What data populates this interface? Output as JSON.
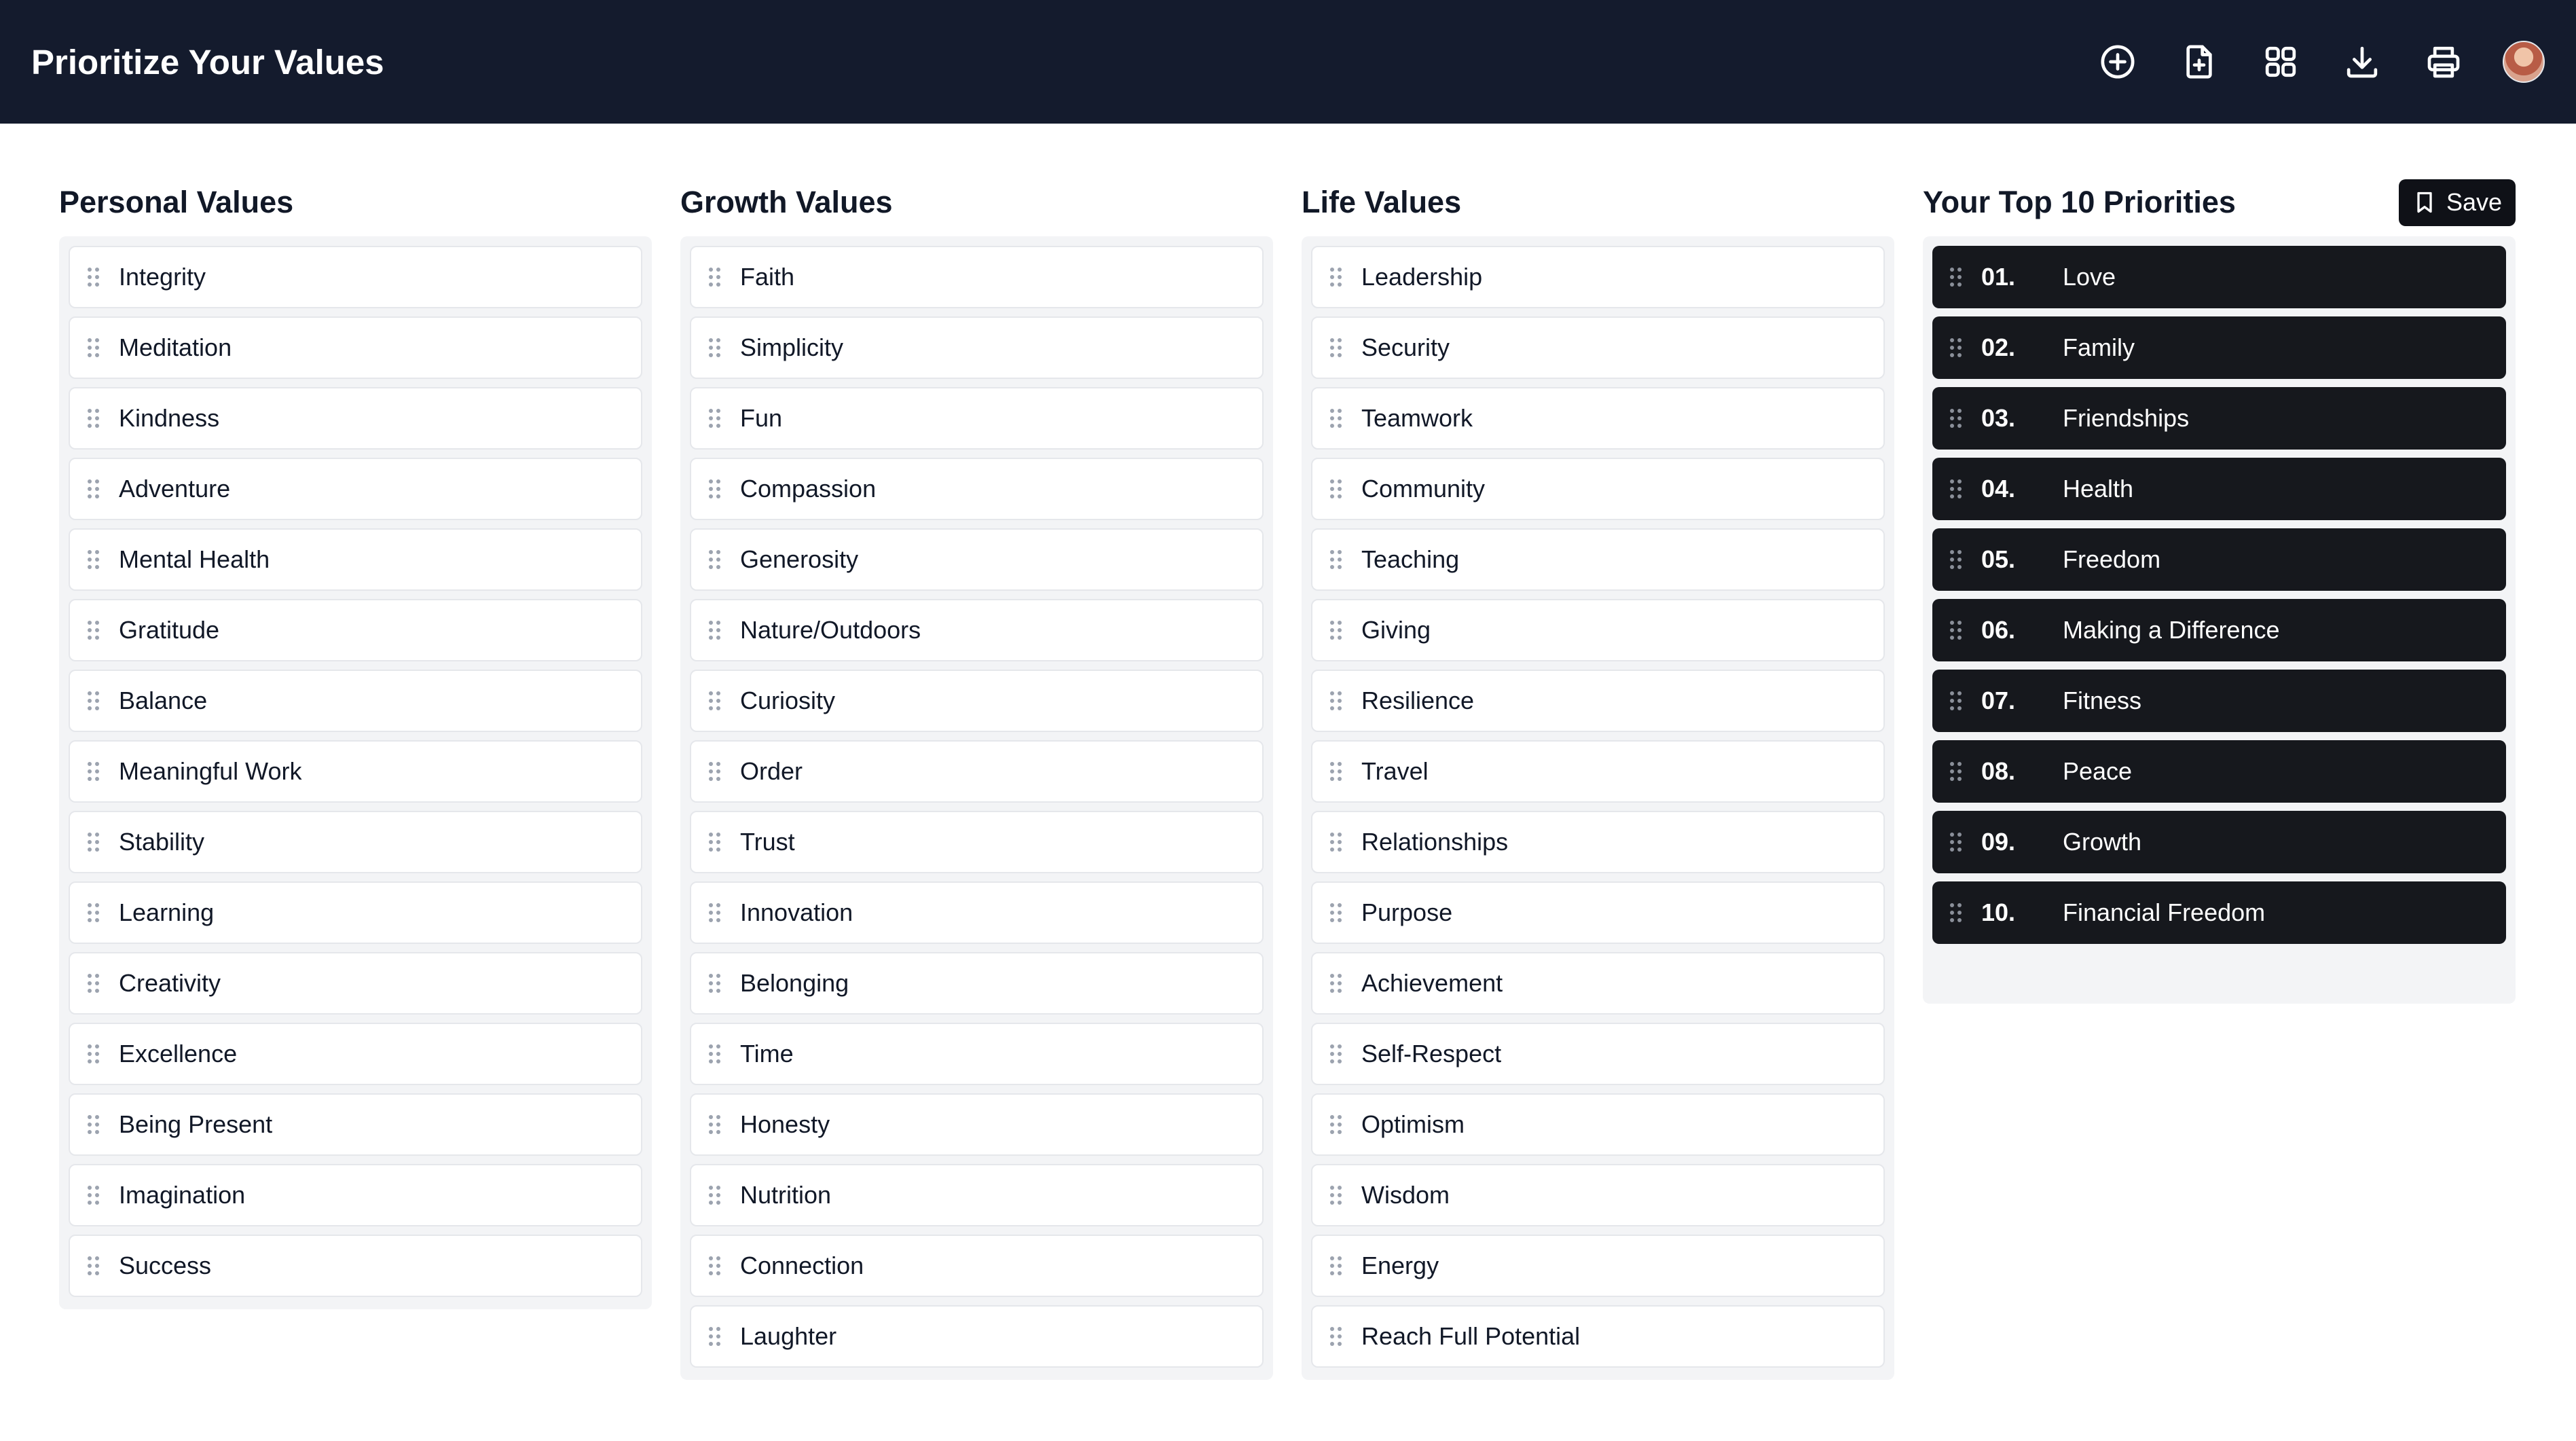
{
  "header": {
    "title": "Prioritize Your Values",
    "icons": [
      "plus-circle-icon",
      "file-plus-icon",
      "grid-icon",
      "download-icon",
      "printer-icon",
      "avatar"
    ]
  },
  "columns": {
    "personal": {
      "title": "Personal Values",
      "items": [
        "Integrity",
        "Meditation",
        "Kindness",
        "Adventure",
        "Mental Health",
        "Gratitude",
        "Balance",
        "Meaningful Work",
        "Stability",
        "Learning",
        "Creativity",
        "Excellence",
        "Being Present",
        "Imagination",
        "Success"
      ]
    },
    "growth": {
      "title": "Growth Values",
      "items": [
        "Faith",
        "Simplicity",
        "Fun",
        "Compassion",
        "Generosity",
        "Nature/Outdoors",
        "Curiosity",
        "Order",
        "Trust",
        "Innovation",
        "Belonging",
        "Time",
        "Honesty",
        "Nutrition",
        "Connection",
        "Laughter"
      ]
    },
    "life": {
      "title": "Life Values",
      "items": [
        "Leadership",
        "Security",
        "Teamwork",
        "Community",
        "Teaching",
        "Giving",
        "Resilience",
        "Travel",
        "Relationships",
        "Purpose",
        "Achievement",
        "Self-Respect",
        "Optimism",
        "Wisdom",
        "Energy",
        "Reach Full Potential"
      ]
    },
    "top": {
      "title": "Your Top 10 Priorities",
      "save_label": "Save",
      "items": [
        {
          "num": "01.",
          "label": "Love"
        },
        {
          "num": "02.",
          "label": "Family"
        },
        {
          "num": "03.",
          "label": "Friendships"
        },
        {
          "num": "04.",
          "label": "Health"
        },
        {
          "num": "05.",
          "label": "Freedom"
        },
        {
          "num": "06.",
          "label": "Making a Difference"
        },
        {
          "num": "07.",
          "label": "Fitness"
        },
        {
          "num": "08.",
          "label": "Peace"
        },
        {
          "num": "09.",
          "label": "Growth"
        },
        {
          "num": "10.",
          "label": "Financial Freedom"
        }
      ]
    }
  },
  "colors": {
    "header_bg": "#141b2d",
    "priority_bg": "#16181d",
    "list_bg": "#f3f4f6"
  }
}
